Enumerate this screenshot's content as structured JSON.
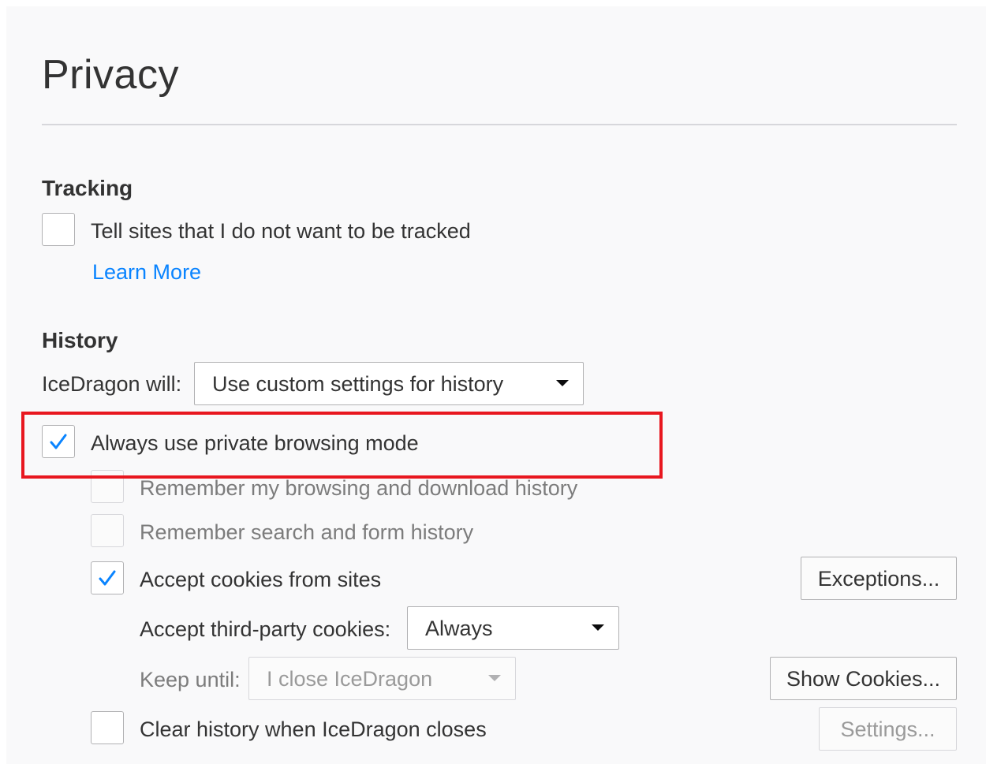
{
  "page": {
    "title": "Privacy"
  },
  "tracking": {
    "heading": "Tracking",
    "do_not_track_label": "Tell sites that I do not want to be tracked",
    "do_not_track_checked": false,
    "learn_more_link": "Learn More"
  },
  "history": {
    "heading": "History",
    "will_label": "IceDragon will:",
    "mode_select_value": "Use custom settings for history",
    "private_mode_label": "Always use private browsing mode",
    "private_mode_checked": true,
    "remember_browsing_label": "Remember my browsing and download history",
    "remember_browsing_checked": false,
    "remember_search_label": "Remember search and form history",
    "remember_search_checked": false,
    "accept_cookies_label": "Accept cookies from sites",
    "accept_cookies_checked": true,
    "exceptions_button": "Exceptions...",
    "third_party_label": "Accept third-party cookies:",
    "third_party_value": "Always",
    "keep_until_label": "Keep until:",
    "keep_until_value": "I close IceDragon",
    "show_cookies_button": "Show Cookies...",
    "clear_history_label": "Clear history when IceDragon closes",
    "clear_history_checked": false,
    "settings_button": "Settings..."
  },
  "colors": {
    "accent": "#0a84ff",
    "check": "#0a84ff",
    "highlight": "#e8171f",
    "background": "#f9f9fa"
  },
  "icons": {
    "checkmark": "checkmark-icon",
    "dropdown": "chevron-down-icon"
  }
}
